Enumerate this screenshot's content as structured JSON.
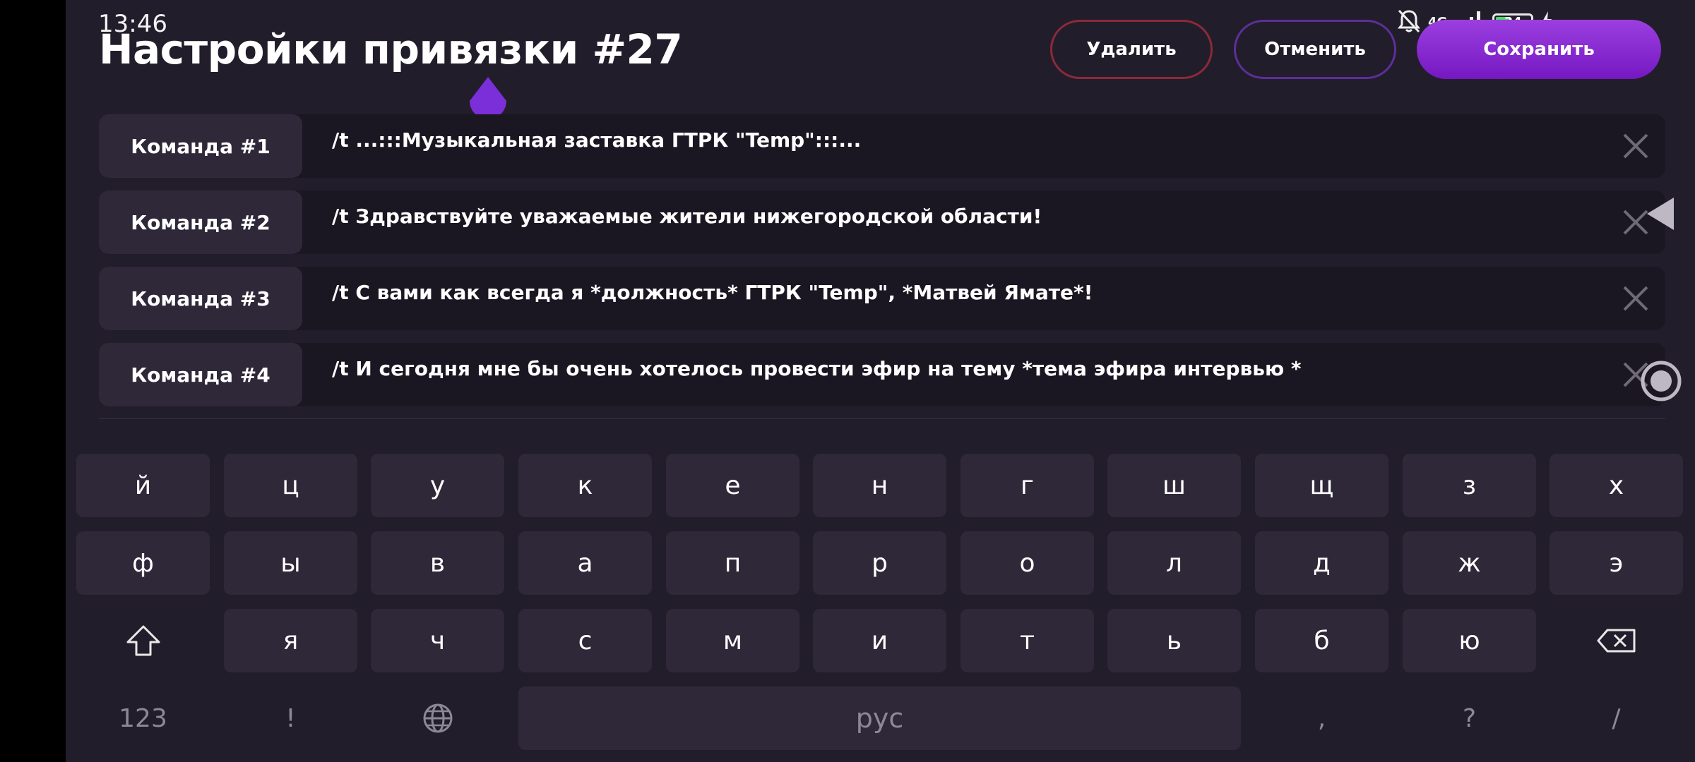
{
  "status_bar": {
    "time": "13:46",
    "network": "4G",
    "battery_percent": "34"
  },
  "header": {
    "title": "Настройки привязки #27",
    "delete_label": "Удалить",
    "cancel_label": "Отменить",
    "save_label": "Сохранить"
  },
  "commands": [
    {
      "label": "Команда #1",
      "text": "/t ...:::Музыкальная заставка ГТРК \"Temp\":::..."
    },
    {
      "label": "Команда #2",
      "text": "/t Здравствуйте уважаемые жители нижегородской области!"
    },
    {
      "label": "Команда #3",
      "text": "/t С вами как всегда я *должность* ГТРК \"Temp\", *Матвей Ямате*!"
    },
    {
      "label": "Команда #4",
      "text": "/t И сегодня мне бы очень хотелось провести эфир на тему *тема эфира интервью *"
    }
  ],
  "keyboard": {
    "row1": [
      "й",
      "ц",
      "у",
      "к",
      "е",
      "н",
      "г",
      "ш",
      "щ",
      "з",
      "х"
    ],
    "row2": [
      "ф",
      "ы",
      "в",
      "а",
      "п",
      "р",
      "о",
      "л",
      "д",
      "ж",
      "э"
    ],
    "row3": [
      "я",
      "ч",
      "с",
      "м",
      "и",
      "т",
      "ь",
      "б",
      "ю"
    ],
    "numbers_key": "123",
    "exclaim_key": "!",
    "space_label": "рус",
    "comma_key": ",",
    "question_key": "?",
    "slash_key": "/"
  },
  "colors": {
    "background": "#221d2a",
    "accent": "#8a2be2",
    "delete_border": "#8a2a3a",
    "key": "#2f2839"
  }
}
